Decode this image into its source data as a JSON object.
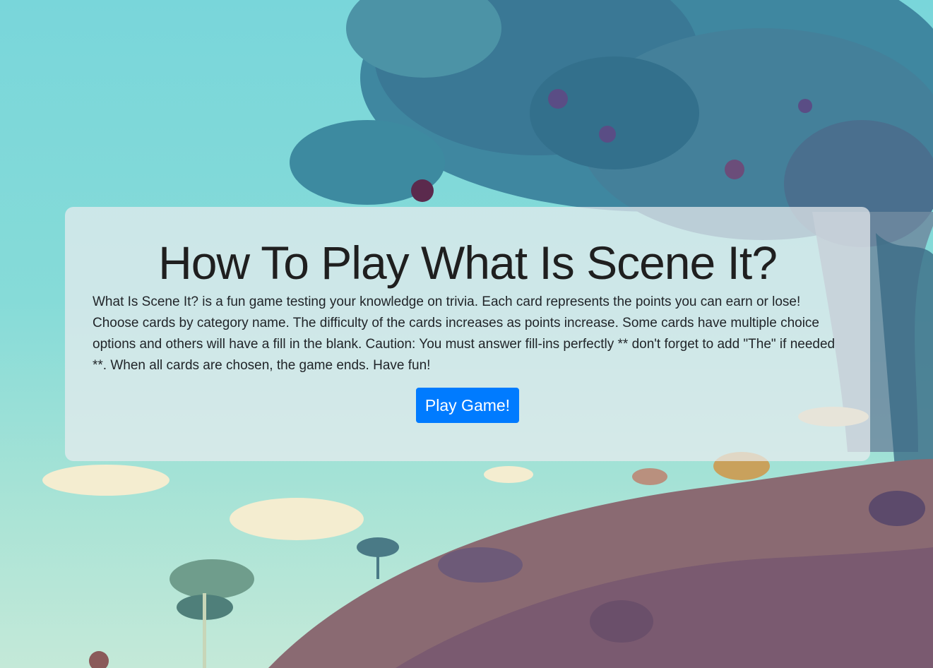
{
  "page": {
    "title": "How To Play What Is Scene It?",
    "description": "What Is Scene It? is a fun game testing your knowledge on trivia. Each card represents the points you can earn or lose! Choose cards by category name. The difficulty of the cards increases as points increase. Some cards have multiple choice options and others will have a fill in the blank. Caution: You must answer fill-ins perfectly ** don't forget to add \"The\" if needed **. When all cards are chosen, the game ends. Have fun!",
    "play_button_label": "Play Game!"
  },
  "colors": {
    "sky": "#79d6da",
    "button": "#007bff",
    "panel": "#e9ecef",
    "hill": "#8a6a72",
    "foliage": "#3e7f9a"
  },
  "icons": {
    "background": "illustrated-jungle-landscape"
  }
}
